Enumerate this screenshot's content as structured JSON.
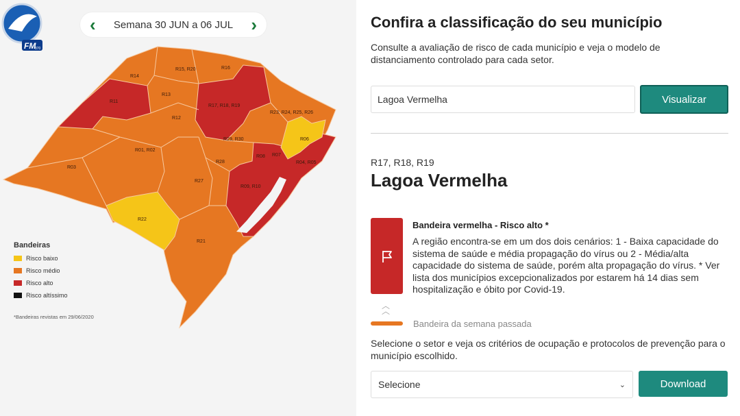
{
  "logo": {
    "text": "FM",
    "sub": "870"
  },
  "week": {
    "label": "Semana 30 JUN a 06 JUL",
    "prev_icon": "chevron-left-icon",
    "next_icon": "chevron-right-icon"
  },
  "map": {
    "regions": [
      {
        "label": "R14",
        "risk": "medio"
      },
      {
        "label": "R15, R20",
        "risk": "medio"
      },
      {
        "label": "R16",
        "risk": "medio"
      },
      {
        "label": "R11",
        "risk": "alto"
      },
      {
        "label": "R13",
        "risk": "medio"
      },
      {
        "label": "R17, R18, R19",
        "risk": "alto"
      },
      {
        "label": "R23, R24, R25, R26",
        "risk": "medio"
      },
      {
        "label": "R12",
        "risk": "medio"
      },
      {
        "label": "R29, R30",
        "risk": "medio"
      },
      {
        "label": "R06",
        "risk": "baixo"
      },
      {
        "label": "R01, R02",
        "risk": "medio"
      },
      {
        "label": "R03",
        "risk": "medio"
      },
      {
        "label": "R28",
        "risk": "medio"
      },
      {
        "label": "R08",
        "risk": "alto"
      },
      {
        "label": "R07",
        "risk": "alto"
      },
      {
        "label": "R04, R05",
        "risk": "alto"
      },
      {
        "label": "R27",
        "risk": "medio"
      },
      {
        "label": "R09, R10",
        "risk": "alto"
      },
      {
        "label": "R22",
        "risk": "baixo"
      },
      {
        "label": "R21",
        "risk": "medio"
      }
    ]
  },
  "legend": {
    "title": "Bandeiras",
    "items": [
      {
        "label": "Risco baixo",
        "color": "#f5c518"
      },
      {
        "label": "Risco médio",
        "color": "#e67722"
      },
      {
        "label": "Risco alto",
        "color": "#c62828"
      },
      {
        "label": "Risco altíssimo",
        "color": "#111111"
      }
    ],
    "note": "*Bandeiras revistas em 29/06/2020"
  },
  "panel": {
    "title": "Confira a classificação do seu município",
    "description": "Consulte a avaliação de risco de cada município e veja o modelo de distanciamento controlado para cada setor.",
    "search_value": "Lagoa Vermelha",
    "visualize_label": "Visualizar",
    "regions": "R17, R18, R19",
    "city": "Lagoa Vermelha",
    "flag_title": "Bandeira vermelha - Risco alto *",
    "flag_description": "A região encontra-se em um dos dois cenários: 1 - Baixa capacidade do sistema de saúde e média propagação do vírus ou 2 - Média/alta capacidade do sistema de saúde, porém alta propagação do vírus. * Ver lista dos municípios excepcionalizados por estarem há 14 dias sem hospitalização e óbito por Covid-19.",
    "flag_color": "#c62828",
    "previous_week_label": "Bandeira da semana passada",
    "previous_week_color": "#e67722",
    "select_description": "Selecione o setor e veja os critérios de ocupação e protocolos de prevenção para o município escolhido.",
    "select_value": "Selecione",
    "download_label": "Download",
    "accent_color": "#1e8a7e"
  }
}
